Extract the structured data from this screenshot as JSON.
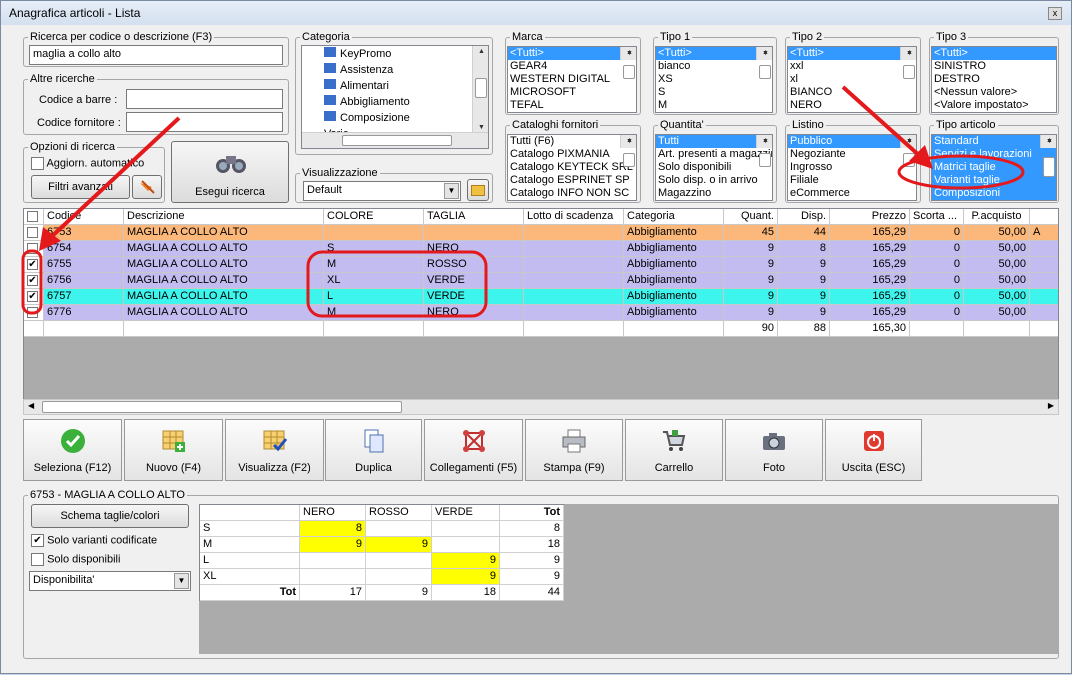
{
  "window": {
    "title": "Anagrafica articoli  - Lista",
    "close": "x"
  },
  "search": {
    "legend": "Ricerca per codice o descrizione (F3)",
    "value": "maglia a collo alto",
    "altre_legend": "Altre ricerche",
    "barcode_label": "Codice a barre :",
    "fornitore_label": "Codice fornitore :",
    "opzioni_legend": "Opzioni di ricerca",
    "aggiorn_label": "Aggiorn. automatico",
    "filtri_label": "Filtri avanzati",
    "esegui_label": "Esegui ricerca"
  },
  "categoria": {
    "legend": "Categoria",
    "items": [
      "KeyPromo",
      "Assistenza",
      "Alimentari",
      "Abbigliamento",
      "Composizione",
      "Varie"
    ]
  },
  "visualizzazione": {
    "legend": "Visualizzazione",
    "value": "Default"
  },
  "marca": {
    "legend": "Marca",
    "items": [
      "<Tutti>",
      "GEAR4",
      "WESTERN DIGITAL",
      "MICROSOFT",
      "TEFAL"
    ]
  },
  "tipo1": {
    "legend": "Tipo 1",
    "items": [
      "<Tutti>",
      "bianco",
      "XS",
      "S",
      "M"
    ]
  },
  "tipo2": {
    "legend": "Tipo 2",
    "items": [
      "<Tutti>",
      "xxl",
      "xl",
      "BIANCO",
      "NERO"
    ]
  },
  "tipo3": {
    "legend": "Tipo 3",
    "items": [
      "<Tutti>",
      "SINISTRO",
      "DESTRO",
      "<Nessun valore>",
      "<Valore impostato>"
    ]
  },
  "cataloghi": {
    "legend": "Cataloghi fornitori",
    "items": [
      "Tutti (F6)",
      "Catalogo PIXMANIA",
      "Catalogo KEYTECK SRL",
      "Catalogo ESPRINET SP",
      "Catalogo INFO NON SC"
    ]
  },
  "quantita": {
    "legend": "Quantita'",
    "items": [
      "Tutti",
      "Art. presenti a magazzino",
      "Solo disponibili",
      "Solo disp. o in arrivo",
      "Magazzino"
    ]
  },
  "listino": {
    "legend": "Listino",
    "items": [
      "Pubblico",
      "Negoziante",
      "Ingrosso",
      "Filiale",
      "eCommerce"
    ]
  },
  "tipo_articolo": {
    "legend": "Tipo articolo",
    "items": [
      "Standard",
      "Servizi e lavorazioni",
      "Matrici taglie",
      "Varianti taglie",
      "Composizioni"
    ]
  },
  "grid": {
    "headers": [
      "",
      "Codice",
      "Descrizione",
      "COLORE",
      "TAGLIA",
      "Lotto di scadenza",
      "Categoria",
      "Quant.",
      "Disp.",
      "Prezzo",
      "Scorta ...",
      "P.acquisto"
    ],
    "rows": [
      {
        "check": "",
        "codice": "6753",
        "descr": "MAGLIA A COLLO ALTO",
        "colore": "",
        "taglia": "",
        "lotto": "",
        "cat": "Abbigliamento",
        "quant": "45",
        "disp": "44",
        "prezzo": "165,29",
        "scorta": "0",
        "pacq": "50,00",
        "extra": "A",
        "bg": "#fbb87a"
      },
      {
        "check": "",
        "codice": "6754",
        "descr": "MAGLIA A COLLO ALTO",
        "colore": "S",
        "taglia": "NERO",
        "lotto": "",
        "cat": "Abbigliamento",
        "quant": "9",
        "disp": "8",
        "prezzo": "165,29",
        "scorta": "0",
        "pacq": "50,00",
        "extra": "",
        "bg": "#c2bcf0"
      },
      {
        "check": "✔",
        "codice": "6755",
        "descr": "MAGLIA A COLLO ALTO",
        "colore": "M",
        "taglia": "ROSSO",
        "lotto": "",
        "cat": "Abbigliamento",
        "quant": "9",
        "disp": "9",
        "prezzo": "165,29",
        "scorta": "0",
        "pacq": "50,00",
        "extra": "",
        "bg": "#c2bcf0"
      },
      {
        "check": "✔",
        "codice": "6756",
        "descr": "MAGLIA A COLLO ALTO",
        "colore": "XL",
        "taglia": "VERDE",
        "lotto": "",
        "cat": "Abbigliamento",
        "quant": "9",
        "disp": "9",
        "prezzo": "165,29",
        "scorta": "0",
        "pacq": "50,00",
        "extra": "",
        "bg": "#c2bcf0"
      },
      {
        "check": "✔",
        "codice": "6757",
        "descr": "MAGLIA A COLLO ALTO",
        "colore": "L",
        "taglia": "VERDE",
        "lotto": "",
        "cat": "Abbigliamento",
        "quant": "9",
        "disp": "9",
        "prezzo": "165,29",
        "scorta": "0",
        "pacq": "50,00",
        "extra": "",
        "bg": "#3ef5ee"
      },
      {
        "check": "",
        "codice": "6776",
        "descr": "MAGLIA A COLLO ALTO",
        "colore": "M",
        "taglia": "NERO",
        "lotto": "",
        "cat": "Abbigliamento",
        "quant": "9",
        "disp": "9",
        "prezzo": "165,29",
        "scorta": "0",
        "pacq": "50,00",
        "extra": "",
        "bg": "#c2bcf0"
      }
    ],
    "totals": {
      "quant": "90",
      "disp": "88",
      "prezzo": "165,30"
    }
  },
  "toolbar": [
    "Seleziona (F12)",
    "Nuovo (F4)",
    "Visualizza (F2)",
    "Duplica",
    "Collegamenti (F5)",
    "Stampa (F9)",
    "Carrello",
    "Foto",
    "Uscita (ESC)"
  ],
  "detail": {
    "legend": "6753 - MAGLIA A COLLO ALTO",
    "schema_label": "Schema taglie/colori",
    "solo_varianti": "Solo varianti codificate",
    "solo_disp": "Solo disponibili",
    "combo": "Disponibilita'"
  },
  "pivot": {
    "cols": [
      "NERO",
      "ROSSO",
      "VERDE",
      "Tot"
    ],
    "rows": [
      {
        "label": "S",
        "vals": [
          "8",
          "",
          ""
        ],
        "tot": "8"
      },
      {
        "label": "M",
        "vals": [
          "9",
          "9",
          ""
        ],
        "tot": "18"
      },
      {
        "label": "L",
        "vals": [
          "",
          "",
          "9"
        ],
        "tot": "9"
      },
      {
        "label": "XL",
        "vals": [
          "",
          "",
          "9"
        ],
        "tot": "9"
      }
    ],
    "tot_label": "Tot",
    "col_tots": [
      "17",
      "9",
      "18"
    ],
    "grand": "44"
  },
  "colors": {
    "selection": "#3399ff",
    "highlight": "#ffff00",
    "annotation": "#e3191c"
  }
}
